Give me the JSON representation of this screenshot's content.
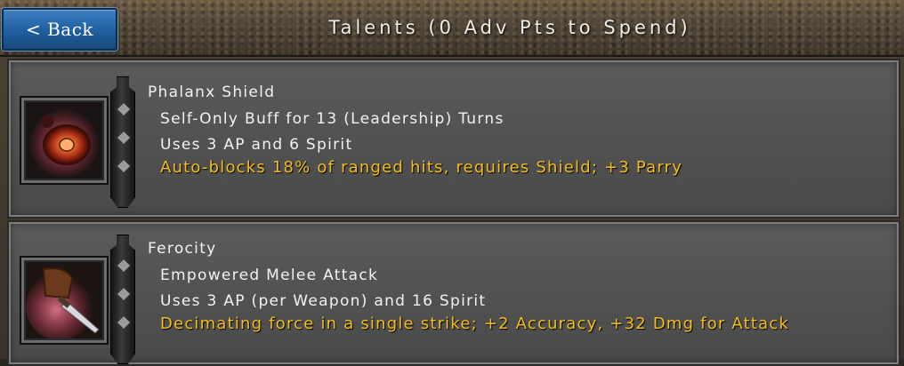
{
  "header": {
    "back_label": "< Back",
    "title": "Talents (0 Adv Pts to Spend)"
  },
  "talents": [
    {
      "name": "Phalanx Shield",
      "line1": "Self-Only Buff for 13 (Leadership) Turns",
      "line2": "Uses 3 AP and 6 Spirit",
      "effect": "Auto-blocks 18% of ranged hits, requires Shield; +3 Parry",
      "icon": "shield-icon"
    },
    {
      "name": "Ferocity",
      "line1": "Empowered Melee Attack",
      "line2": "Uses 3 AP (per Weapon) and 16 Spirit",
      "effect": "Decimating force in a single strike; +2 Accuracy, +32 Dmg for Attack",
      "icon": "sword-icon"
    }
  ],
  "colors": {
    "effect_text": "#f5bd1e",
    "back_button": "#2a6bb0"
  }
}
